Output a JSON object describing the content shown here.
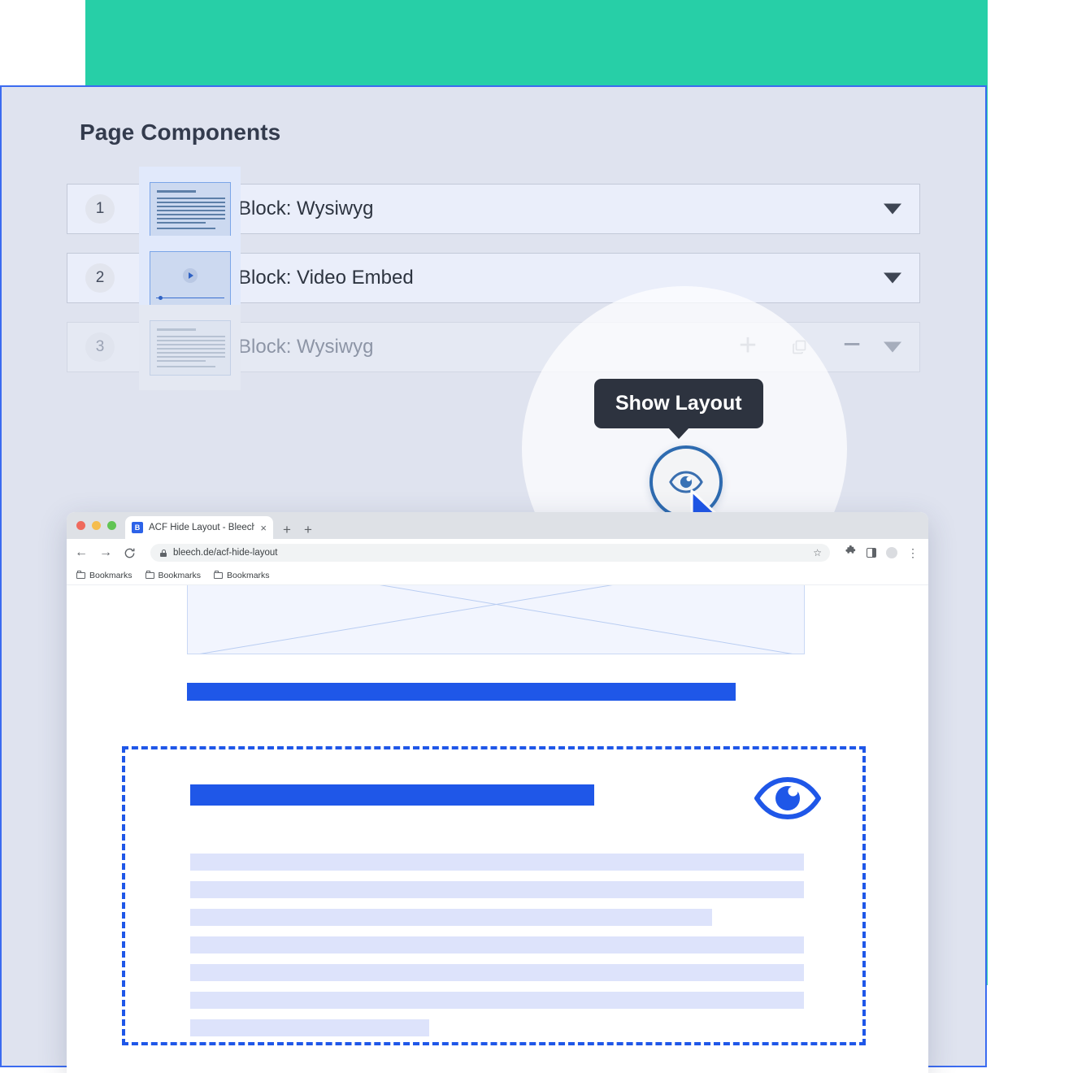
{
  "theme": {
    "accent_teal": "#27cfa7",
    "accent_blue": "#1f57e8",
    "panel_bg": "#dfe3ef",
    "row_bg": "#eaeefa",
    "tooltip_bg": "#2d333f",
    "text_dark": "#2d3440",
    "text_muted": "#8d95a6"
  },
  "panel": {
    "title": "Page Components",
    "rows": [
      {
        "order": "1",
        "label": "Block: Wysiwyg",
        "thumbnail": "wysiwyg-preview-icon",
        "caret": "chevron-down-icon",
        "hidden": false
      },
      {
        "order": "2",
        "label": "Block: Video Embed",
        "thumbnail": "video-embed-preview-icon",
        "caret": "chevron-down-icon",
        "hidden": false
      },
      {
        "order": "3",
        "label": "Block: Wysiwyg",
        "thumbnail": "wysiwyg-preview-icon",
        "caret": "chevron-down-icon",
        "hidden": true
      }
    ],
    "row_actions": {
      "toggle_visibility": "eye-icon",
      "add": "+",
      "duplicate": "copy-icon",
      "remove": "−",
      "collapse": "chevron-down-icon"
    }
  },
  "tooltip": {
    "label": "Show Layout"
  },
  "cursor": {
    "icon": "mouse-pointer-icon"
  },
  "browser": {
    "traffic_lights": [
      "close",
      "minimize",
      "zoom"
    ],
    "tab": {
      "favicon_letter": "B",
      "title": "ACF Hide Layout - Bleech",
      "close": "×"
    },
    "new_tab": "+",
    "extra_tab": "+",
    "toolbar": {
      "back": "←",
      "forward": "→",
      "reload": "⟳",
      "lock": "lock-icon",
      "url": "bleech.de/acf-hide-layout",
      "bookmark_star": "☆",
      "extensions": "puzzle-icon",
      "side_panel": "side-panel-icon",
      "profile": "avatar-icon",
      "menu": "⋮"
    },
    "bookmarks": [
      {
        "label": "Bookmarks"
      },
      {
        "label": "Bookmarks"
      },
      {
        "label": "Bookmarks"
      }
    ]
  },
  "preview_page": {
    "image_placeholder": "image-placeholder",
    "heading_bar": "heading-placeholder",
    "highlighted_block": {
      "heading_bar": "block-heading-placeholder",
      "eye_icon": "eye-icon",
      "text_lines": [
        100,
        100,
        85,
        100,
        100,
        100,
        39
      ]
    }
  }
}
